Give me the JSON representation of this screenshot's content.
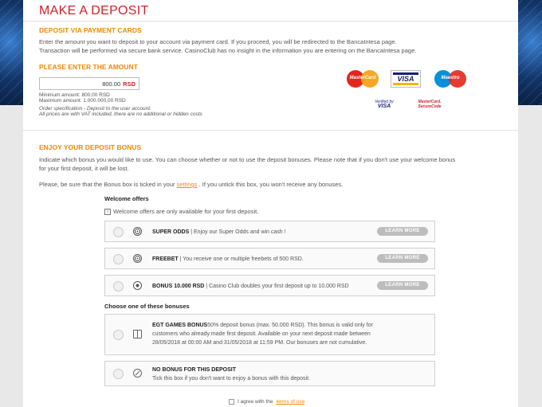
{
  "page_title": "MAKE A DEPOSIT",
  "payment": {
    "heading": "DEPOSIT VIA PAYMENT CARDS",
    "desc_line1": "Enter the amount you want to deposit to your account via payment card. If you proceed, you will be redirected to the BancaIntesa page.",
    "desc_line2": "Transaction will be performed via secure bank service. CasinoClub has no insight in the information you are entering on the BancaIntesa page."
  },
  "amount": {
    "heading": "PLEASE ENTER THE AMOUNT",
    "value": "800.00",
    "currency": "RSD",
    "min": "Minimum amount: 800,00 RSD",
    "max": "Maximum amount: 1.000.000,00 RSD",
    "spec": "Order specification - Deposit to the user account.",
    "vat": "All prices are with VAT included, there are no additional or hidden costs"
  },
  "card_logos": {
    "mastercard": "MasterCard",
    "visa": "VISA",
    "maestro": "Maestro",
    "verified_line1": "Verified by",
    "verified_line2": "VISA",
    "securecode_line1": "MasterCard.",
    "securecode_line2": "SecureCode"
  },
  "bonus": {
    "heading": "ENJOY YOUR DEPOSIT BONUS",
    "desc_line1": "Indicate which bonus you would like to use. You can choose whether or not to use the deposit bonuses. Please note that if you don't use your welcome bonus",
    "desc_line2": "for your first deposit, it will be lost.",
    "note_before": "Please, be sure that the Bonus box is ticked in your",
    "note_link": "settings",
    "note_after": ". If you untick this box, you won't receive any bonuses.",
    "welcome_heading": "Welcome offers",
    "welcome_info": "Welcome offers are only available for your first deposit.",
    "learn_more": "LEARN MORE",
    "welcome_offers": [
      {
        "name": "SUPER ODDS",
        "desc": " | Enjoy our Super Odds and win cash !"
      },
      {
        "name": "FREEBET",
        "desc": " | You receive one or multiple freebets of 500 RSD."
      },
      {
        "name": "BONUS 10.000 RSD",
        "desc": " | Casino Club doubles your first deposit up to 10.000 RSD"
      }
    ],
    "choose_heading": "Choose one of these bonuses",
    "egt": {
      "name": "EGT GAMES BONUS",
      "line1": "50% deposit bonus (max. 50.000 RSD). This bonus is valid only for",
      "line2": "customers who already made first deposit. Available on your next deposit made between",
      "line3": "28/05/2018 at 00:00 AM and 31/05/2018 at 11:59 PM. Our bonuses are not cumulative."
    },
    "no_bonus": {
      "name": "NO BONUS FOR THIS DEPOSIT",
      "desc": "Tick this box if you don't want to enjoy a bonus with this deposit."
    }
  },
  "terms": {
    "before": "I agree with the",
    "link": "terms of use"
  }
}
